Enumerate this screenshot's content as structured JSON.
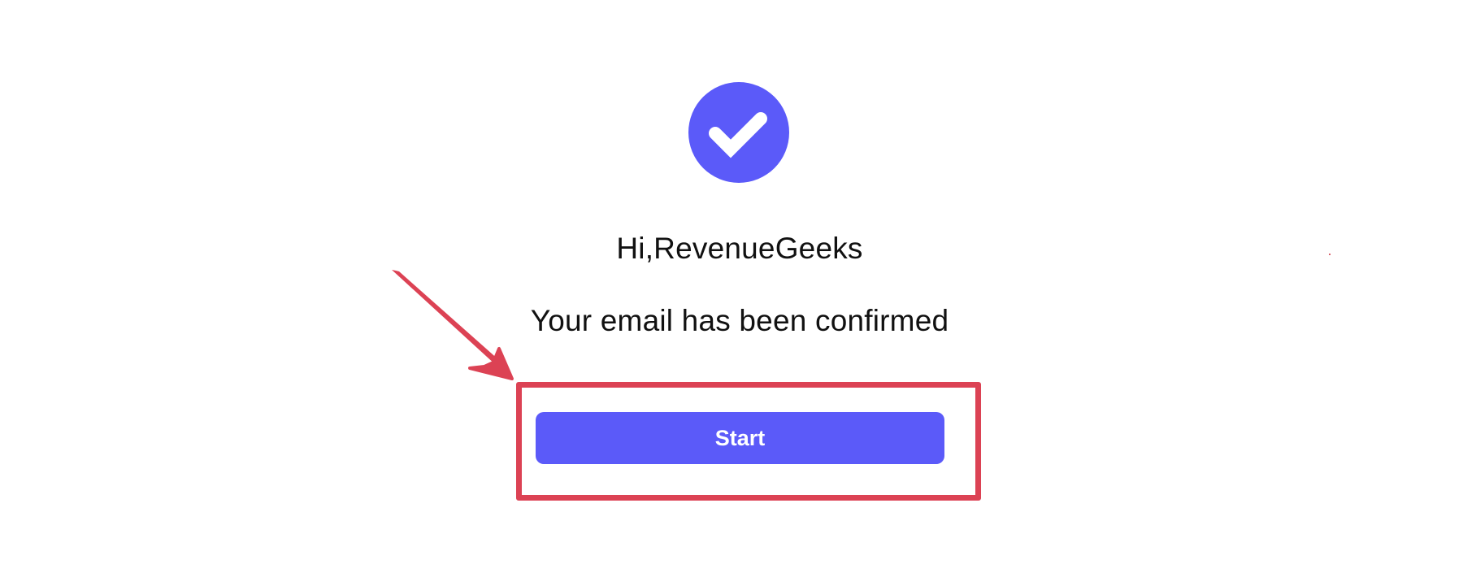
{
  "confirmation": {
    "icon": "check-circle-icon",
    "greeting": "Hi,RevenueGeeks",
    "message": "Your email has been confirmed",
    "start_label": "Start"
  },
  "annotation": {
    "arrow_icon": "red-arrow-icon",
    "highlight_color": "#dc4254"
  },
  "colors": {
    "accent": "#5b5af9",
    "background": "#ffffff",
    "text": "#111111"
  }
}
